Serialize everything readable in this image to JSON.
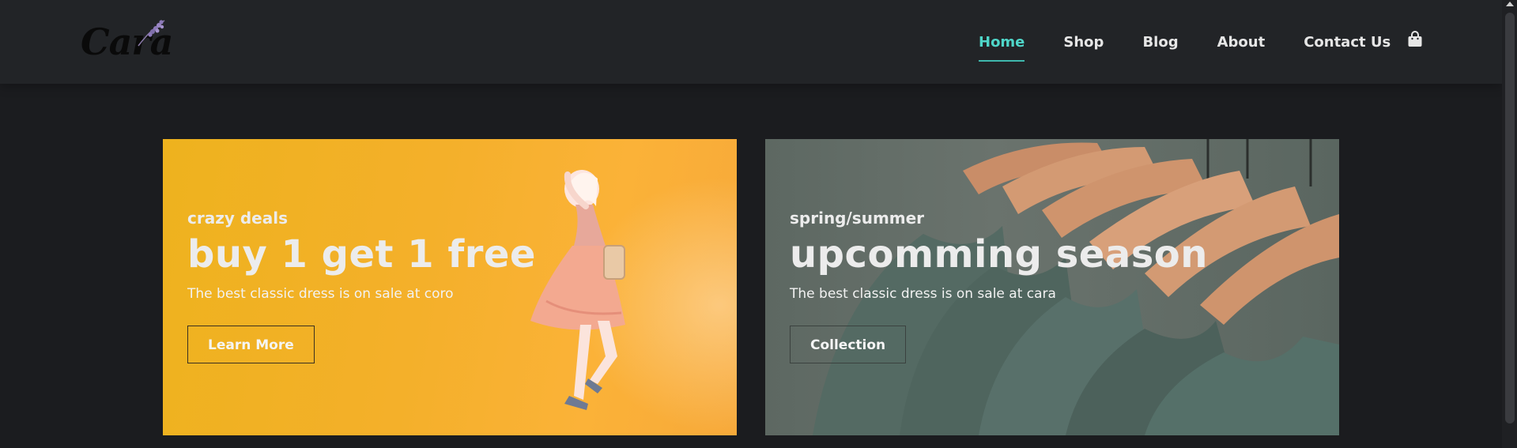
{
  "header": {
    "logo_text": "Cara",
    "nav": [
      {
        "label": "Home",
        "active": true
      },
      {
        "label": "Shop"
      },
      {
        "label": "Blog"
      },
      {
        "label": "About"
      },
      {
        "label": "Contact Us"
      }
    ],
    "cart_icon": "shopping-bag-icon"
  },
  "banners": [
    {
      "subtitle": "crazy deals",
      "title": "buy 1 get 1 free",
      "description": "The best classic dress is on sale at coro",
      "button": "Learn More",
      "image": "woman-in-dress"
    },
    {
      "subtitle": "spring/summer",
      "title": "upcomming season",
      "description": "The best classic dress is on sale at cara",
      "button": "Collection",
      "image": "shirts-on-hangers"
    }
  ],
  "colors": {
    "accent": "#4fd6c9",
    "header_bg": "#222427",
    "page_bg": "#1b1c1f",
    "banner_left_bg": "#f4b02a",
    "banner_right_bg": "#5d6862"
  }
}
